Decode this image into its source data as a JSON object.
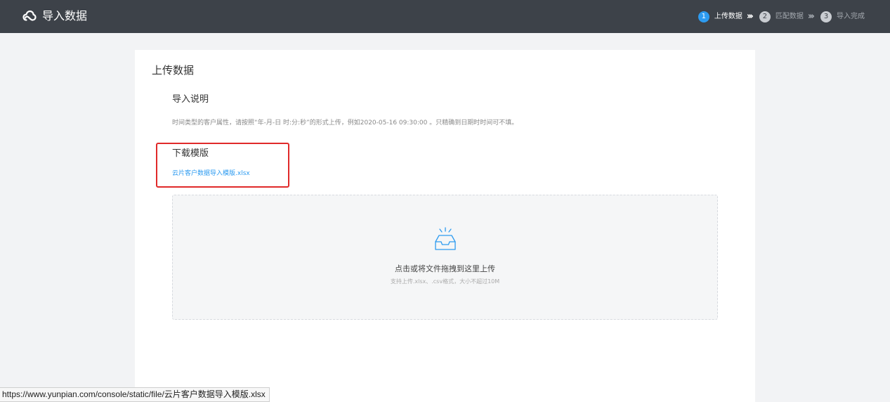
{
  "header": {
    "title": "导入数据",
    "logo_icon": "cloud-logo-icon"
  },
  "steps": [
    {
      "number": "1",
      "label": "上传数据",
      "active": true
    },
    {
      "number": "2",
      "label": "匹配数据",
      "active": false
    },
    {
      "number": "3",
      "label": "导入完成",
      "active": false
    }
  ],
  "step_separator": "›››",
  "panel": {
    "title": "上传数据",
    "instructions_title": "导入说明",
    "instructions_text": "时间类型的客户属性，请按照“年-月-日 时:分:秒”的形式上传，例如2020-05-16 09:30:00 。只精确到日期时时间可不填。",
    "download_title": "下载模版",
    "download_link": "云片客户数据导入模版.xlsx"
  },
  "dropzone": {
    "icon": "inbox-upload-icon",
    "main_text": "点击或将文件拖拽到这里上传",
    "hint_text": "支持上传.xlsx、.csv格式，大小不超过10M"
  },
  "status_bar": {
    "url": "https://www.yunpian.com/console/static/file/云片客户数据导入模版.xlsx"
  },
  "colors": {
    "header_bg": "#3d4249",
    "accent": "#2d9bf0",
    "highlight_border": "#e02a2a",
    "page_bg": "#f2f3f5"
  }
}
